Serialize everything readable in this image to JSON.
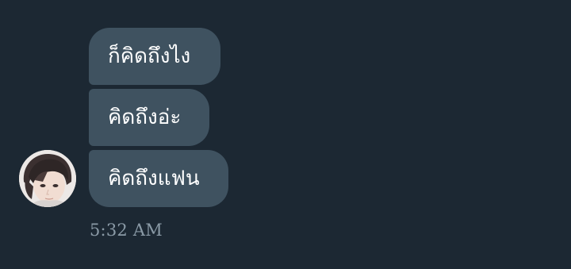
{
  "conversation": {
    "messages": [
      {
        "text": "ก็คิดถึงไง"
      },
      {
        "text": "คิดถึงอ่ะ"
      },
      {
        "text": "คิดถึงแฟน"
      }
    ],
    "timestamp": "5:32 AM"
  },
  "colors": {
    "background": "#1c2833",
    "bubble": "#3f5260",
    "bubble_text": "#ffffff",
    "timestamp_text": "#8a9aa6"
  },
  "icons": {
    "avatar": "user-avatar-photo"
  }
}
